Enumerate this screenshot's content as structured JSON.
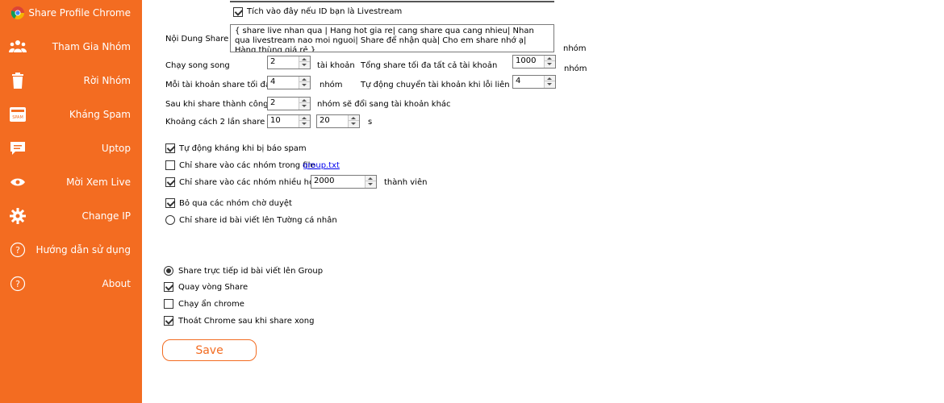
{
  "sidebar": {
    "items": [
      {
        "label": "Share Profile Chrome",
        "icon": "chrome-icon"
      },
      {
        "label": "Tham Gia Nhóm",
        "icon": "group-icon"
      },
      {
        "label": "Rời Nhóm",
        "icon": "trash-icon"
      },
      {
        "label": "Kháng Spam",
        "icon": "spam-icon"
      },
      {
        "label": "Uptop",
        "icon": "chat-icon"
      },
      {
        "label": "Mời Xem Live",
        "icon": "eye-icon"
      },
      {
        "label": "Change IP",
        "icon": "gear-icon"
      },
      {
        "label": "Hướng dẫn sử dụng",
        "icon": "help-icon"
      },
      {
        "label": "About",
        "icon": "help-icon"
      }
    ],
    "color": "#f36c21"
  },
  "form": {
    "livestream_checkbox": "Tích vào đây nếu ID bạn là Livestream",
    "content_label": "Nội Dung Share",
    "content_value": "{ share live nhan qua | Hang hot gia re| cang share qua cang nhieu| Nhan qua livestream nao moi nguoi| Share để nhận quà| Cho em share nhớ ạ| Hàng thùng giá rẻ }",
    "nhom_right": "nhóm",
    "parallel_label": "Chạy song song",
    "parallel_value": "2",
    "parallel_unit": "tài khoản",
    "total_label": "Tổng share tối đa tất cả tài khoản",
    "total_value": "1000",
    "total_unit": "nhóm",
    "per_account_label": "Mỗi tài khoản share tối đa",
    "per_account_value": "4",
    "per_account_unit": "nhóm",
    "auto_switch_label": "Tự động chuyển tài khoản khi lỗi liên tục",
    "auto_switch_value": "4",
    "after_success_label": "Sau khi share thành công",
    "after_success_value": "2",
    "after_success_unit": "nhóm sẽ đổi sang tài khoản khác",
    "interval_label": "Khoảng cách 2 lần share",
    "interval_min": "10",
    "interval_max": "20",
    "interval_unit": "s",
    "auto_spam": "Tự động kháng khi bị báo spam",
    "only_file": "Chỉ share vào các nhóm trong file",
    "only_file_link": "group.txt",
    "only_more": "Chỉ share vào các nhóm nhiều hơn",
    "only_more_value": "2000",
    "only_more_unit": "thành viên",
    "skip_pending": "Bỏ qua các nhóm chờ duyệt",
    "only_wall": "Chỉ share id bài viết lên Tường cá nhân",
    "share_direct": "Share trực tiếp id bài viết lên Group",
    "loop_share": "Quay vòng Share",
    "hidden_chrome": "Chạy ẩn chrome",
    "quit_chrome": "Thoát Chrome sau khi share xong",
    "save_label": "Save"
  }
}
